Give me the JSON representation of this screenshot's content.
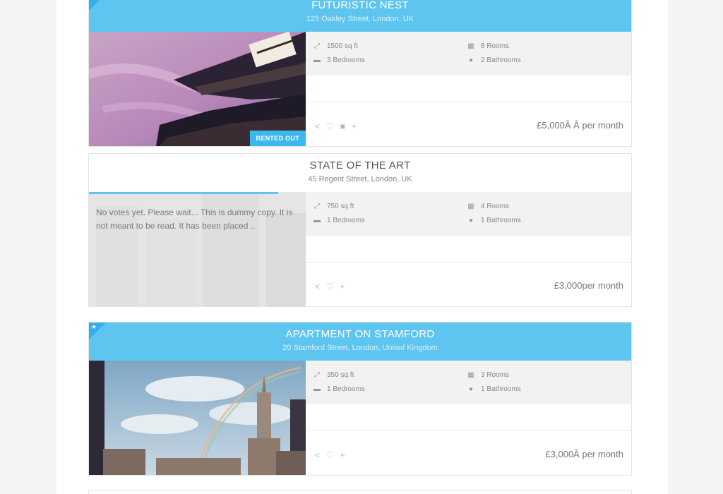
{
  "listings": [
    {
      "title": "FUTURISTIC NEST",
      "address": "125 Oakley Street, London, UK",
      "badge": "RENTED OUT",
      "area": "1500 sq ft",
      "rooms": "8 Rooms",
      "bedrooms": "3 Bedrooms",
      "bathrooms": "2 Bathrooms",
      "price": "£5,000Â Â per month"
    },
    {
      "title": "STATE OF THE ART",
      "address": "45 Regent Street, London, UK",
      "overlay_note": "No votes yet. Please wait... This is dummy copy. It is not meant to be read. It has been placed ..",
      "area": "750 sq ft",
      "rooms": "4 Rooms",
      "bedrooms": "1 Bedrooms",
      "bathrooms": "1 Bathrooms",
      "price": "£3,000per month"
    },
    {
      "title": "APARTMENT ON STAMFORD",
      "address": "20 Stamford Street, London, United Kingdom",
      "area": "350 sq ft",
      "rooms": "3 Rooms",
      "bedrooms": "1 Bedrooms",
      "bathrooms": "1 Bathrooms",
      "price": "£3,000Â per month"
    }
  ],
  "icons": {
    "featured": "star-icon",
    "area": "resize-arrows-icon",
    "rooms": "building-icon",
    "bedrooms": "bed-icon",
    "bathrooms": "water-drop-icon",
    "share": "share-icon",
    "favorite": "heart-icon",
    "video": "video-camera-icon",
    "compare": "plus-icon"
  },
  "colors": {
    "accent": "#5ec5f0",
    "ribbon": "#2fb0ea",
    "badge": "#3db8ee",
    "details_bg": "#f2f2f2"
  }
}
